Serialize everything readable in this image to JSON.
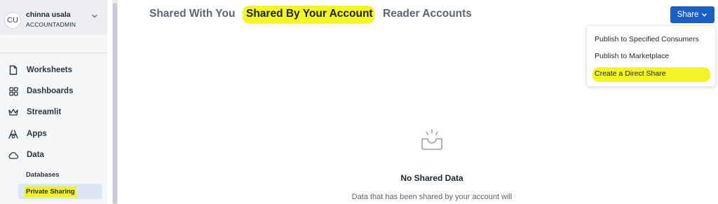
{
  "user": {
    "initials": "CU",
    "name": "chinna usala",
    "role": "ACCOUNTADMIN"
  },
  "sidebar": {
    "items": [
      {
        "label": "Worksheets",
        "icon": "document-icon"
      },
      {
        "label": "Dashboards",
        "icon": "grid-icon"
      },
      {
        "label": "Streamlit",
        "icon": "crown-icon"
      },
      {
        "label": "Apps",
        "icon": "apps-icon"
      },
      {
        "label": "Data",
        "icon": "cloud-icon"
      }
    ],
    "sub_items": [
      {
        "label": "Databases",
        "active": false
      },
      {
        "label": "Private Sharing",
        "active": true
      }
    ]
  },
  "tabs": [
    {
      "label": "Shared With You",
      "active": false
    },
    {
      "label": "Shared By Your Account",
      "active": true
    },
    {
      "label": "Reader Accounts",
      "active": false
    }
  ],
  "share": {
    "label": "Share",
    "menu": [
      "Publish to Specified Consumers",
      "Publish to Marketplace",
      "Create a Direct Share"
    ]
  },
  "empty_state": {
    "title": "No Shared Data",
    "description": "Data that has been shared by your account will"
  },
  "colors": {
    "accent": "#1a5fc6",
    "highlight": "#f3f529",
    "sidebar_bg": "#f5f6f8"
  }
}
